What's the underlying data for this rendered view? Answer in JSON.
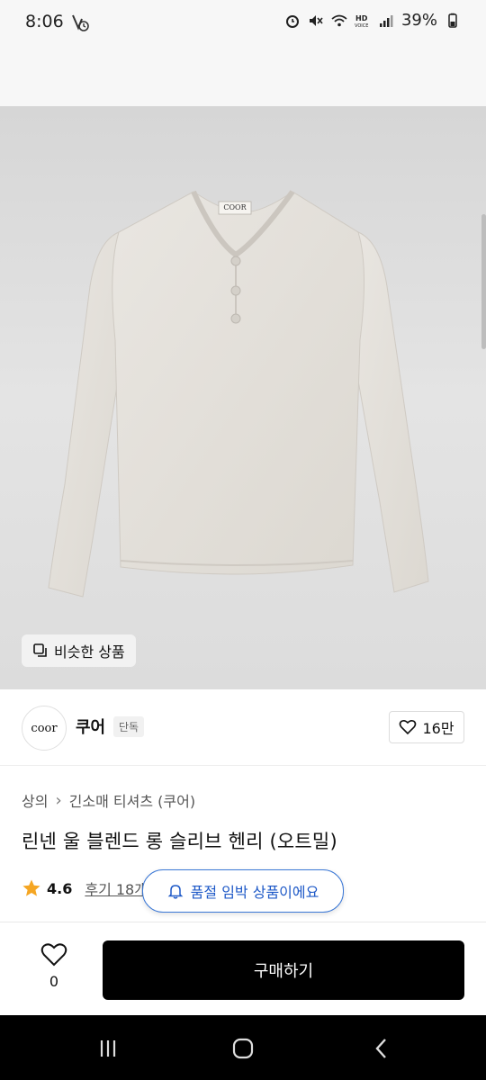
{
  "status": {
    "time": "8:06",
    "battery_percent": "39%",
    "icons": [
      "alarm-icon",
      "mute-icon",
      "wifi-icon",
      "hd-voice-icon",
      "signal-icon",
      "battery-icon"
    ]
  },
  "hero": {
    "image": "linen-henley-longsleeve-oatmeal",
    "neck_label": "COOR",
    "similar_button": "비슷한 상품"
  },
  "brand": {
    "logo_text": "coor",
    "name": "쿠어",
    "tag": "단독",
    "likes": "16만"
  },
  "breadcrumb": {
    "category": "상의",
    "separator": "›",
    "subcategory": "긴소매 티셔츠 (쿠어)"
  },
  "product": {
    "title": "린넨 울 블렌드 롱 슬리브 헨리 (오트밀)",
    "rating": "4.6",
    "reviews": "후기 18개"
  },
  "toast": {
    "text": "품절 임박 상품이에요"
  },
  "bottom": {
    "wish_count": "0",
    "buy_label": "구매하기"
  },
  "colors": {
    "accent_blue": "#1e59c7",
    "star": "#f5a623",
    "button_black": "#000000"
  }
}
